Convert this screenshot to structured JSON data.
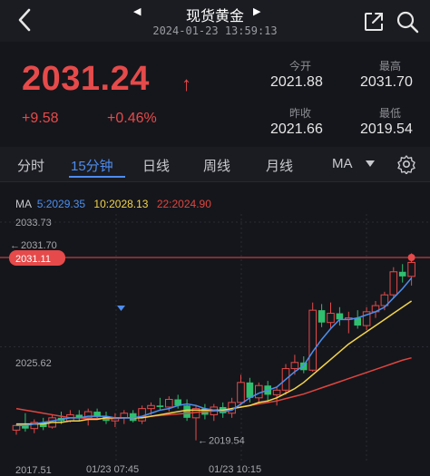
{
  "header": {
    "title": "现货黄金",
    "timestamp": "2024-01-23 13:59:13",
    "prev_arrow": "◀",
    "next_arrow": "▶"
  },
  "quote": {
    "price": "2031.24",
    "direction": "↑",
    "change": "+9.58",
    "change_pct": "+0.46%",
    "stats": [
      {
        "label": "今开",
        "value": "2021.88"
      },
      {
        "label": "最高",
        "value": "2031.70"
      },
      {
        "label": "昨收",
        "value": "2021.66"
      },
      {
        "label": "最低",
        "value": "2019.54"
      }
    ]
  },
  "tabs": [
    "分时",
    "15分钟",
    "日线",
    "周线",
    "月线",
    "MA"
  ],
  "active_tab": "15分钟",
  "ma_legend": {
    "prefix": "MA",
    "ma5": "5:2029.35",
    "ma10": "10:2028.13",
    "ma22": "22:2024.90"
  },
  "colors": {
    "up": "#e64a4a",
    "down": "#2fbf6f",
    "accent": "#4d8cf0",
    "ma5": "#4c8ff0",
    "ma10": "#f2d44c",
    "ma22": "#e0453f"
  },
  "chart_data": {
    "type": "candlestick",
    "y_ticks": [
      "2033.73",
      "2025.62",
      "2017.51"
    ],
    "x_ticks": [
      "01/23 07:45",
      "01/23 10:15"
    ],
    "current_price_label": "2031.11",
    "high_marker": "2031.70",
    "low_marker": "2019.54",
    "ylim": [
      2017.51,
      2033.73
    ],
    "candles": [
      [
        2020.2,
        2020.6,
        2019.9,
        2020.5
      ],
      [
        2020.5,
        2021.3,
        2020.1,
        2020.3
      ],
      [
        2020.3,
        2020.9,
        2020.0,
        2020.7
      ],
      [
        2020.7,
        2021.0,
        2020.2,
        2020.4
      ],
      [
        2020.4,
        2021.2,
        2020.3,
        2021.0
      ],
      [
        2021.0,
        2021.4,
        2020.6,
        2020.8
      ],
      [
        2020.8,
        2021.5,
        2020.7,
        2021.2
      ],
      [
        2021.2,
        2021.5,
        2020.8,
        2021.0
      ],
      [
        2021.0,
        2021.6,
        2020.5,
        2021.4
      ],
      [
        2021.4,
        2021.6,
        2020.9,
        2021.1
      ],
      [
        2021.1,
        2021.4,
        2020.6,
        2020.8
      ],
      [
        2020.8,
        2021.3,
        2020.4,
        2021.0
      ],
      [
        2021.0,
        2021.5,
        2020.6,
        2021.3
      ],
      [
        2021.3,
        2021.5,
        2020.7,
        2020.8
      ],
      [
        2020.8,
        2021.8,
        2020.6,
        2021.6
      ],
      [
        2021.6,
        2022.0,
        2021.2,
        2021.8
      ],
      [
        2021.8,
        2022.3,
        2021.5,
        2021.7
      ],
      [
        2021.7,
        2022.4,
        2021.4,
        2022.2
      ],
      [
        2022.2,
        2022.5,
        2021.6,
        2021.8
      ],
      [
        2021.8,
        2022.2,
        2020.8,
        2021.0
      ],
      [
        2021.0,
        2021.8,
        2019.54,
        2021.6
      ],
      [
        2021.6,
        2021.9,
        2020.9,
        2021.2
      ],
      [
        2021.2,
        2021.9,
        2020.8,
        2021.7
      ],
      [
        2021.7,
        2022.0,
        2021.0,
        2021.3
      ],
      [
        2021.3,
        2022.3,
        2021.0,
        2022.0
      ],
      [
        2022.0,
        2023.8,
        2021.8,
        2023.3
      ],
      [
        2023.3,
        2023.6,
        2022.0,
        2022.3
      ],
      [
        2022.3,
        2023.3,
        2021.9,
        2023.1
      ],
      [
        2023.1,
        2023.4,
        2022.0,
        2022.5
      ],
      [
        2022.5,
        2023.0,
        2021.8,
        2022.8
      ],
      [
        2022.8,
        2024.5,
        2022.5,
        2024.2
      ],
      [
        2024.2,
        2025.1,
        2023.8,
        2024.6
      ],
      [
        2024.6,
        2025.0,
        2023.9,
        2024.1
      ],
      [
        2024.1,
        2028.5,
        2024.0,
        2028.0
      ],
      [
        2028.0,
        2028.4,
        2026.9,
        2027.2
      ],
      [
        2027.2,
        2028.5,
        2026.8,
        2027.8
      ],
      [
        2027.8,
        2028.2,
        2027.0,
        2027.4
      ],
      [
        2027.4,
        2027.9,
        2026.5,
        2027.5
      ],
      [
        2027.5,
        2028.0,
        2026.8,
        2027.0
      ],
      [
        2027.0,
        2028.2,
        2026.7,
        2027.9
      ],
      [
        2027.9,
        2028.6,
        2027.5,
        2028.3
      ],
      [
        2028.3,
        2029.2,
        2028.0,
        2029.0
      ],
      [
        2029.0,
        2030.8,
        2028.8,
        2030.5
      ],
      [
        2030.5,
        2031.0,
        2029.8,
        2030.2
      ],
      [
        2030.2,
        2031.7,
        2029.6,
        2031.11
      ]
    ],
    "ma5": [
      2020.5,
      2020.5,
      2020.6,
      2020.7,
      2020.8,
      2020.9,
      2021.0,
      2021.0,
      2021.1,
      2021.1,
      2021.1,
      2021.0,
      2021.0,
      2021.0,
      2021.1,
      2021.3,
      2021.5,
      2021.6,
      2021.8,
      2021.9,
      2021.8,
      2021.6,
      2021.5,
      2021.4,
      2021.5,
      2021.9,
      2022.3,
      2022.6,
      2022.8,
      2023.0,
      2023.5,
      2024.0,
      2024.4,
      2025.3,
      2026.1,
      2026.8,
      2027.4,
      2027.4,
      2027.5,
      2027.7,
      2027.9,
      2028.2,
      2028.8,
      2029.4,
      2030.1
    ],
    "ma10": [
      2020.6,
      2020.6,
      2020.6,
      2020.6,
      2020.7,
      2020.7,
      2020.8,
      2020.8,
      2020.9,
      2020.9,
      2021.0,
      2021.0,
      2021.0,
      2021.0,
      2021.0,
      2021.1,
      2021.2,
      2021.3,
      2021.4,
      2021.5,
      2021.5,
      2021.5,
      2021.5,
      2021.5,
      2021.6,
      2021.7,
      2021.8,
      2022.0,
      2022.1,
      2022.3,
      2022.6,
      2022.9,
      2023.3,
      2023.8,
      2024.3,
      2024.8,
      2025.3,
      2025.8,
      2026.2,
      2026.6,
      2027.0,
      2027.4,
      2027.8,
      2028.2,
      2028.6
    ],
    "ma22": [
      2021.6,
      2021.5,
      2021.4,
      2021.3,
      2021.2,
      2021.1,
      2021.0,
      2021.0,
      2020.95,
      2020.95,
      2020.95,
      2020.95,
      2021.0,
      2021.0,
      2021.05,
      2021.1,
      2021.15,
      2021.2,
      2021.25,
      2021.3,
      2021.35,
      2021.4,
      2021.45,
      2021.5,
      2021.6,
      2021.7,
      2021.8,
      2021.9,
      2022.0,
      2022.1,
      2022.25,
      2022.4,
      2022.55,
      2022.75,
      2022.95,
      2023.15,
      2023.35,
      2023.55,
      2023.75,
      2023.95,
      2024.15,
      2024.35,
      2024.55,
      2024.75,
      2024.9
    ]
  }
}
